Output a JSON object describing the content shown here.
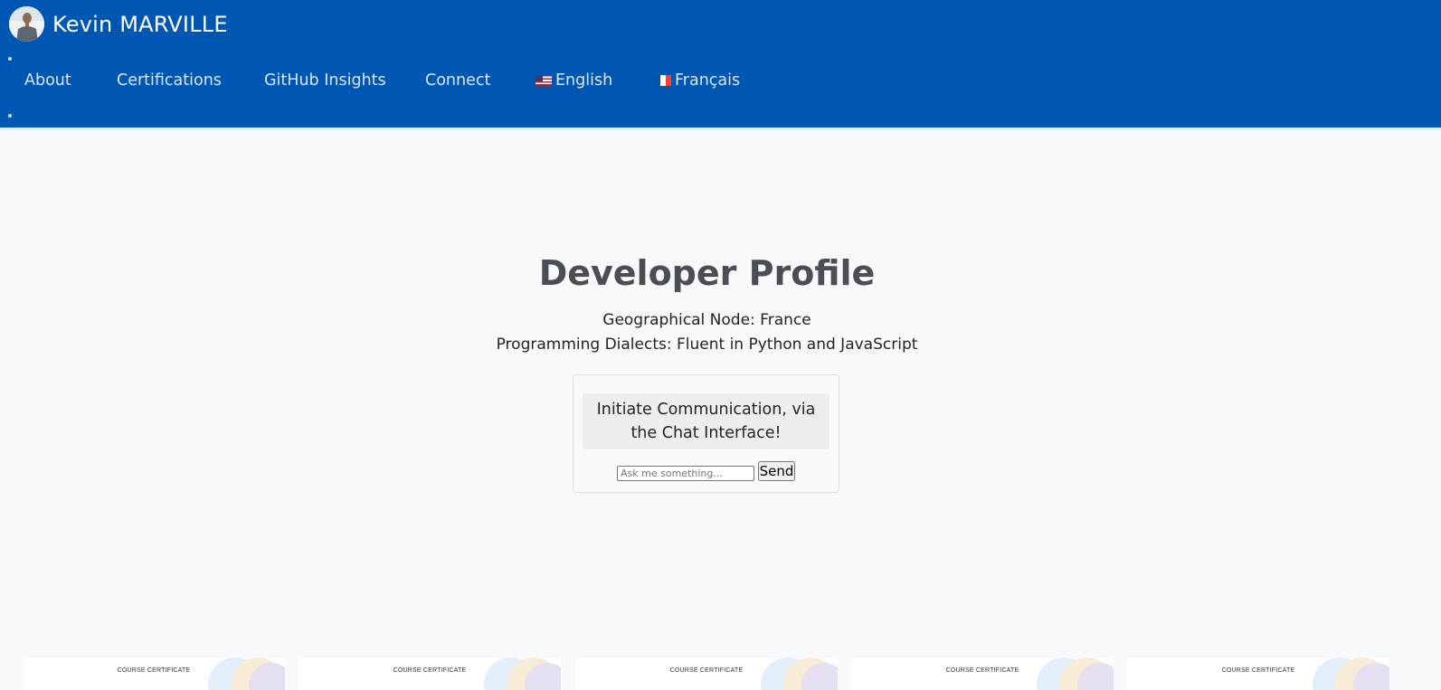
{
  "header": {
    "brand_name": "Kevin MARVILLE",
    "nav": [
      {
        "label": "About"
      },
      {
        "label": "Certifications"
      },
      {
        "label": "GitHub Insights"
      },
      {
        "label": "Connect"
      },
      {
        "label": "English",
        "flag": "us-flag-icon"
      },
      {
        "label": "Français",
        "flag": "fr-flag-icon"
      }
    ],
    "colors": {
      "background": "#0056b3",
      "text": "#dbe6f3"
    }
  },
  "profile": {
    "title": "Developer Profile",
    "location": "Geographical Node: France",
    "languages": "Programming Dialects: Fluent in Python and JavaScript"
  },
  "chat": {
    "header": "Initiate Communication, via the Chat Interface!",
    "input_placeholder": "Ask me something...",
    "send_label": "Send"
  },
  "certificates": [
    {
      "label": "COURSE CERTIFICATE"
    },
    {
      "label": "COURSE CERTIFICATE"
    },
    {
      "label": "COURSE CERTIFICATE"
    },
    {
      "label": "COURSE CERTIFICATE"
    },
    {
      "label": "COURSE CERTIFICATE"
    }
  ]
}
